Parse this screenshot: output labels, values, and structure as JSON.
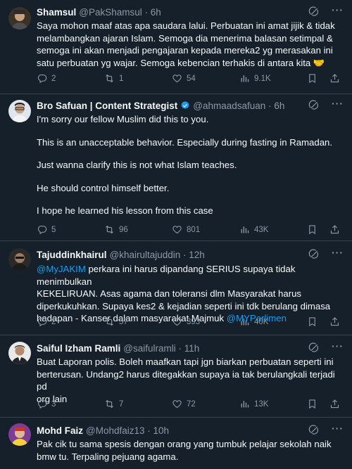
{
  "tweets": [
    {
      "name": "Shamsul",
      "handle": "@PakShamsul",
      "time": "6h",
      "verified": false,
      "lines": [
        "Saya mohon maaf atas apa saudara lalui. Perbuatan ini amat jijik & tidak",
        "melambangkan ajaran Islam. Semoga dia menerima balasan setimpal &",
        "semoga ini akan menjadi pengajaran kepada mereka2 yg merasakan ini",
        "satu perbuatan yg wajar. Semoga kebencian terhakis di antara kita 🤝"
      ],
      "replies": "2",
      "retweets": "1",
      "likes": "54",
      "views": "9.1K"
    },
    {
      "name": "Bro Safuan | Content Strategist",
      "handle": "@ahmaadsafuan",
      "time": "6h",
      "verified": true,
      "paragraphs": [
        "I'm sorry our fellow Muslim did this to you.",
        "This is an unacceptable behavior. Especially during fasting in Ramadan.",
        "Just wanna clarify this is not what Islam teaches.",
        "He should control himself better.",
        "I hope he learned his lesson from this case"
      ],
      "replies": "5",
      "retweets": "96",
      "likes": "801",
      "views": "43K"
    },
    {
      "name": "Tajuddinkhairul",
      "handle": "@khairultajuddin",
      "time": "12h",
      "verified": false,
      "mention1": "@MyJAKIM",
      "line1_rest": " perkara ini harus dipandang SERIUS supaya tidak menimbulkan",
      "line2": "KEKELIRUAN. Asas agama dan toleransi  dlm Masyarakat harus",
      "line3": "diperkukuhkan. Supaya kes2 & kejadian seperti ini tdk berulang dimasa",
      "line4": "hadapan - Kanser dalam masyarakat Majmuk ",
      "mention2": "@MYParlimen",
      "replies": "2",
      "retweets": "57",
      "likes": "393",
      "views": "40K"
    },
    {
      "name": "Saiful Izham Ramli",
      "handle": "@saifulramli",
      "time": "11h",
      "verified": false,
      "lines": [
        "Buat Laporan polis. Boleh maafkan tapi jgn biarkan perbuatan seperti ini",
        "berterusan. Undang2 harus ditegakkan supaya ia tak berulangkali terjadi pd",
        "org lain"
      ],
      "replies": "3",
      "retweets": "7",
      "likes": "72",
      "views": "13K"
    },
    {
      "name": "Mohd Faiz",
      "handle": "@Mohdfaiz13",
      "time": "10h",
      "verified": false,
      "lines": [
        "Pak cik tu sama spesis dengan orang yang tumbuk pelajar sekolah naik",
        "bmw tu. Terpaling pejuang agama."
      ]
    }
  ],
  "colors": {
    "bg": "#15202b",
    "text": "#f7f9f9",
    "muted": "#8b98a5",
    "accent": "#1d9bf0",
    "divider": "#38444d"
  },
  "icons": [
    "grok-icon",
    "more-icon",
    "reply-icon",
    "retweet-icon",
    "like-icon",
    "views-icon",
    "bookmark-icon",
    "share-icon",
    "verified-badge-icon"
  ]
}
